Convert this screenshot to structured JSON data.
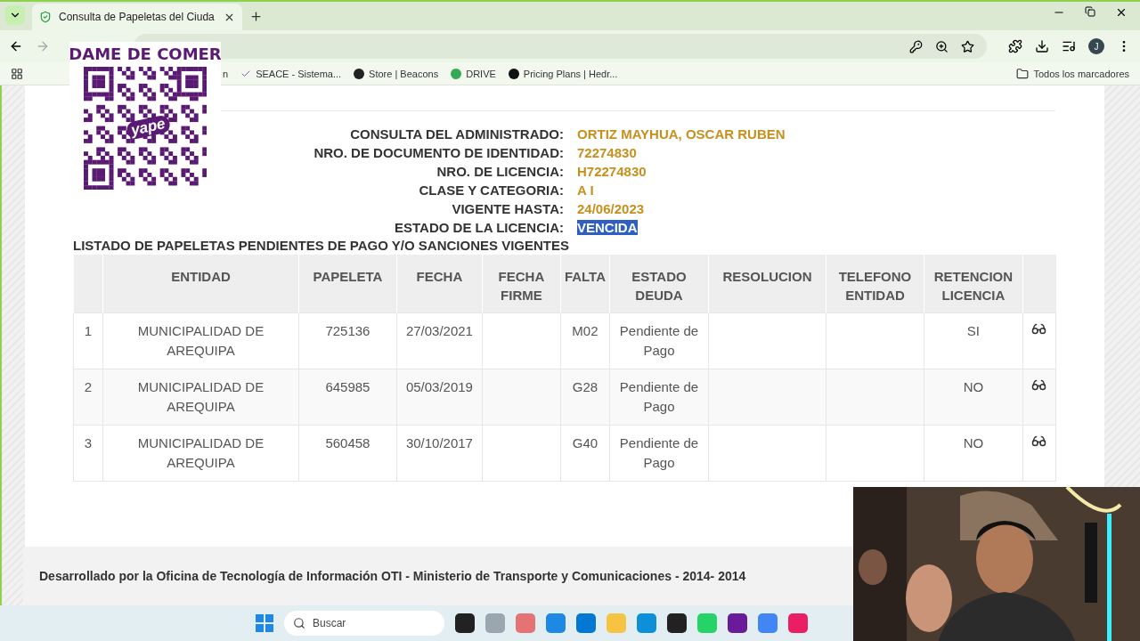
{
  "browser": {
    "tab_title": "Consulta de Papeletas del Ciuda",
    "profile": "J",
    "bookmarks": [
      {
        "label": "n",
        "kind": "plain"
      },
      {
        "label": "SEACE - Sistema...",
        "kind": "check"
      },
      {
        "label": "Store | Beacons",
        "kind": "dot"
      },
      {
        "label": "DRIVE",
        "kind": "drive"
      },
      {
        "label": "Pricing Plans | Hedr...",
        "kind": "dark"
      }
    ],
    "all_bookmarks": "Todos los marcadores"
  },
  "info": [
    {
      "label": "CONSULTA DEL ADMINISTRADO:",
      "value": "ORTIZ MAYHUA, OSCAR RUBEN",
      "selected": false
    },
    {
      "label": "NRO. DE DOCUMENTO DE IDENTIDAD:",
      "value": "72274830",
      "selected": false
    },
    {
      "label": "NRO. DE LICENCIA:",
      "value": "H72274830",
      "selected": false
    },
    {
      "label": "CLASE Y CATEGORIA:",
      "value": "A I",
      "selected": false
    },
    {
      "label": "VIGENTE HASTA:",
      "value": "24/06/2023",
      "selected": false
    },
    {
      "label": "ESTADO DE LA LICENCIA:",
      "value": "VENCIDA",
      "selected": true
    }
  ],
  "list_title": "LISTADO DE PAPELETAS PENDIENTES DE PAGO Y/O SANCIONES VIGENTES",
  "table": {
    "columns": [
      "ENTIDAD",
      "PAPELETA",
      "FECHA",
      "FECHA FIRME",
      "FALTA",
      "ESTADO DEUDA",
      "RESOLUCION",
      "TELEFONO ENTIDAD",
      "RETENCION LICENCIA"
    ],
    "rows": [
      {
        "number": "1",
        "entidad": "MUNICIPALIDAD DE AREQUIPA",
        "papeleta": "725136",
        "fecha": "27/03/2021",
        "falta": "M02",
        "estado": "Pendiente de Pago",
        "retencion": "SI"
      },
      {
        "number": "2",
        "entidad": "MUNICIPALIDAD DE AREQUIPA",
        "papeleta": "645985",
        "fecha": "05/03/2019",
        "falta": "G28",
        "estado": "Pendiente de Pago",
        "retencion": "NO"
      },
      {
        "number": "3",
        "entidad": "MUNICIPALIDAD DE AREQUIPA",
        "papeleta": "560458",
        "fecha": "30/10/2017",
        "falta": "G40",
        "estado": "Pendiente de Pago",
        "retencion": "NO"
      }
    ]
  },
  "footer": "Desarrollado por la Oficina de Tecnología de Información OTI - Ministerio de Transporte y Comunicaciones - 2014- 2014",
  "taskbar": {
    "search_placeholder": "Buscar"
  },
  "overlay": {
    "title": "DAME DE COMER",
    "qr_logo": "yape"
  }
}
